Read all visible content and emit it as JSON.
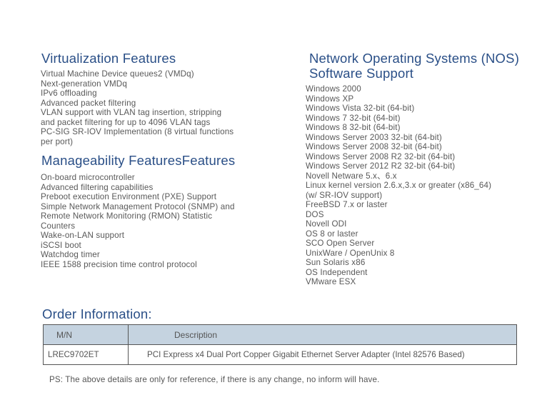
{
  "virtualization": {
    "title": "Virtualization Features",
    "items": [
      "Virtual Machine Device queues2 (VMDq)",
      "Next-generation VMDq",
      "IPv6 offloading",
      "Advanced packet filtering",
      "VLAN support with VLAN tag insertion, stripping",
      "and packet filtering for up to 4096 VLAN tags",
      "PC-SIG SR-IOV Implementation (8 virtual functions",
      "per port)"
    ]
  },
  "manageability": {
    "title": "Manageability FeaturesFeatures",
    "items": [
      "On-board microcontroller",
      "Advanced filtering capabilities",
      "Preboot execution Environment (PXE) Support",
      "Simple Network Management Protocol (SNMP) and",
      "Remote Network Monitoring (RMON) Statistic",
      "Counters",
      "Wake-on-LAN support",
      "iSCSI boot",
      "Watchdog timer",
      "IEEE 1588 precision time control protocol"
    ]
  },
  "nos": {
    "title": "Network Operating Systems (NOS) Software Support",
    "items": [
      "Windows 2000",
      "Windows XP",
      "Windows Vista 32-bit (64-bit)",
      "Windows 7 32-bit (64-bit)",
      "Windows 8 32-bit (64-bit)",
      "Windows Server 2003 32-bit (64-bit)",
      "Windows Server 2008 32-bit (64-bit)",
      "Windows Server 2008 R2 32-bit (64-bit)",
      "Windows Server 2012 R2 32-bit (64-bit)",
      "Novell Netware 5.x、6.x",
      "Linux kernel version 2.6.x,3.x or greater (x86_64)",
      "(w/ SR-IOV support)",
      "FreeBSD 7.x or laster",
      "DOS",
      "Novell ODI",
      "OS 8 or laster",
      "SCO Open Server",
      "UnixWare / OpenUnix 8",
      "Sun Solaris x86",
      "OS Independent",
      "VMware ESX"
    ]
  },
  "order": {
    "title": "Order Information:",
    "headers": {
      "mn": "M/N",
      "description": "Description"
    },
    "rows": [
      {
        "mn": "LREC9702ET",
        "description": "PCI Express x4 Dual Port Copper Gigabit Ethernet Server Adapter (Intel 82576 Based)"
      }
    ]
  },
  "note": "PS: The above details are only for reference, if there is any change, no inform will have.",
  "colors": {
    "heading": "#2a4f87",
    "body_text": "#555555",
    "table_header_bg": "#c5d3e0"
  }
}
